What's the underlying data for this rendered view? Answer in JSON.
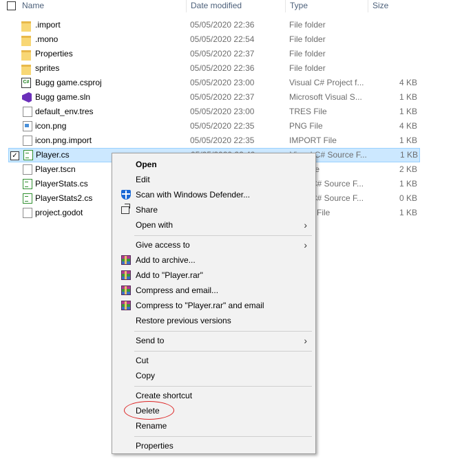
{
  "header": {
    "name": "Name",
    "date": "Date modified",
    "type": "Type",
    "size": "Size"
  },
  "files": [
    {
      "name": ".import",
      "date": "05/05/2020 22:36",
      "type": "File folder",
      "size": "",
      "icon": "folder-icon"
    },
    {
      "name": ".mono",
      "date": "05/05/2020 22:54",
      "type": "File folder",
      "size": "",
      "icon": "folder-icon"
    },
    {
      "name": "Properties",
      "date": "05/05/2020 22:37",
      "type": "File folder",
      "size": "",
      "icon": "folder-icon"
    },
    {
      "name": "sprites",
      "date": "05/05/2020 22:36",
      "type": "File folder",
      "size": "",
      "icon": "folder-icon"
    },
    {
      "name": "Bugg game.csproj",
      "date": "05/05/2020 23:00",
      "type": "Visual C# Project f...",
      "size": "4 KB",
      "icon": "csproj-icon"
    },
    {
      "name": "Bugg game.sln",
      "date": "05/05/2020 22:37",
      "type": "Microsoft Visual S...",
      "size": "1 KB",
      "icon": "sln-icon"
    },
    {
      "name": "default_env.tres",
      "date": "05/05/2020 23:00",
      "type": "TRES File",
      "size": "1 KB",
      "icon": "document-icon"
    },
    {
      "name": "icon.png",
      "date": "05/05/2020 22:35",
      "type": "PNG File",
      "size": "4 KB",
      "icon": "image-icon"
    },
    {
      "name": "icon.png.import",
      "date": "05/05/2020 22:35",
      "type": "IMPORT File",
      "size": "1 KB",
      "icon": "document-icon"
    },
    {
      "name": "Player.cs",
      "date": "05/05/2020 22:40",
      "type": "Visual C# Source F...",
      "size": "1 KB",
      "icon": "cs-file-icon",
      "selected": true
    },
    {
      "name": "Player.tscn",
      "date": "",
      "type": "ile",
      "size": "2 KB",
      "icon": "document-icon"
    },
    {
      "name": "PlayerStats.cs",
      "date": "",
      "type": "C# Source F...",
      "size": "1 KB",
      "icon": "cs-file-icon"
    },
    {
      "name": "PlayerStats2.cs",
      "date": "",
      "type": "C# Source F...",
      "size": "0 KB",
      "icon": "cs-file-icon"
    },
    {
      "name": "project.godot",
      "date": "",
      "type": "File",
      "size": "1 KB",
      "icon": "document-icon"
    }
  ],
  "context_menu": {
    "items": {
      "open": "Open",
      "edit": "Edit",
      "scan": "Scan with Windows Defender...",
      "share": "Share",
      "open_with": "Open with",
      "give_access": "Give access to",
      "add_archive": "Add to archive...",
      "add_rar": "Add to \"Player.rar\"",
      "compress_email": "Compress and email...",
      "compress_rar_email": "Compress to \"Player.rar\" and email",
      "restore": "Restore previous versions",
      "send_to": "Send to",
      "cut": "Cut",
      "copy": "Copy",
      "create_shortcut": "Create shortcut",
      "delete": "Delete",
      "rename": "Rename",
      "properties": "Properties"
    },
    "arrow_glyph": "›"
  },
  "annotation": {
    "color": "#dd2222",
    "target": "Delete"
  }
}
